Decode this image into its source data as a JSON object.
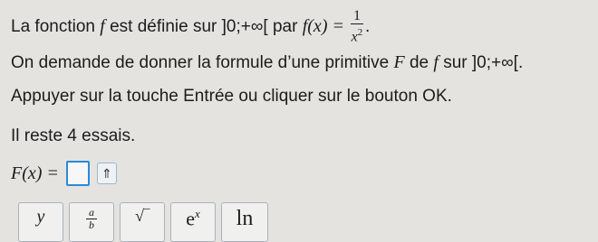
{
  "prompt": {
    "line1_pre": "La fonction ",
    "f": "f",
    "line1_mid": " est définie sur ]0;+∞[ par ",
    "fx": "f(x) = ",
    "num": "1",
    "den_base": "x",
    "den_exp": "2",
    "line1_end": ".",
    "line2": "On demande de donner la formule d’une primitive ",
    "F": "F",
    "line2_mid": " de ",
    "line2_end": " sur ]0;+∞[.",
    "line3": "Appuyer sur la touche Entrée ou cliquer sur le bouton OK.",
    "line4": "Il reste 4 essais."
  },
  "answer": {
    "label": "F(x) =",
    "value": "",
    "shift_icon": "⇑"
  },
  "toolbar": [
    {
      "name": "power-button",
      "label": "y"
    },
    {
      "name": "fraction-button",
      "num": "a",
      "den": "b"
    },
    {
      "name": "sqrt-button",
      "label": "√‾"
    },
    {
      "name": "exp-button",
      "base": "e",
      "sup": "x"
    },
    {
      "name": "ln-button",
      "label": "ln"
    }
  ]
}
